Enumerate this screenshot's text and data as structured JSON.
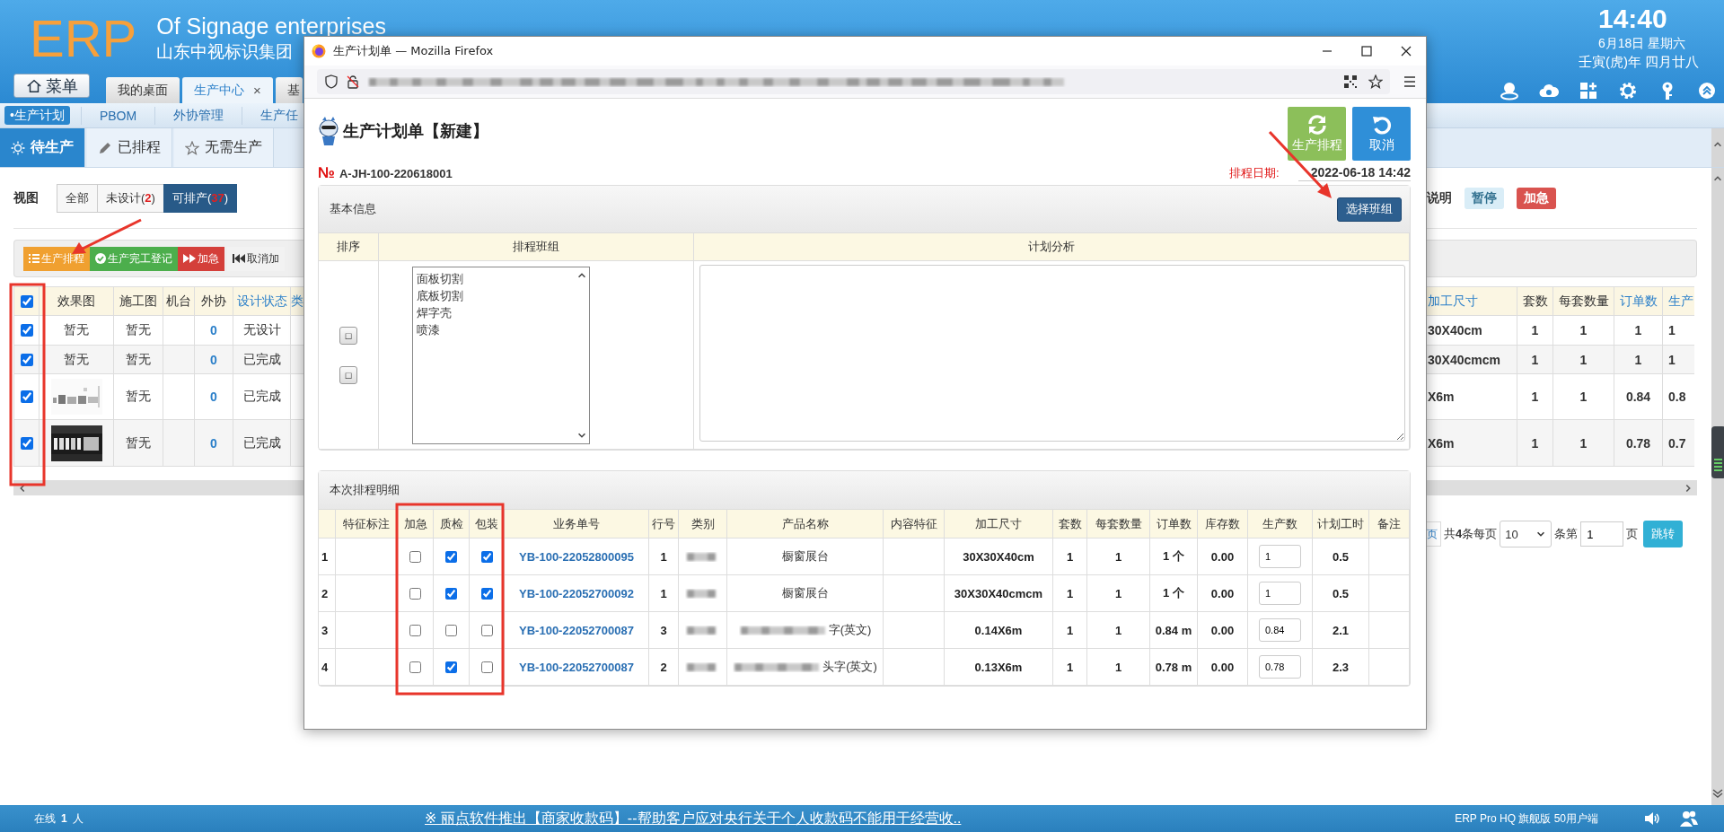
{
  "header": {
    "logo": "ERP",
    "company_en": "Of Signage enterprises",
    "company_cn": "山东中视标识集团",
    "clock": {
      "time": "14:40",
      "date": "6月18日 星期六",
      "lunar": "壬寅(虎)年 四月廿八"
    }
  },
  "menu_button": {
    "label": "菜单"
  },
  "tabs": [
    {
      "label": "我的桌面",
      "selected": false
    },
    {
      "label": "生产中心",
      "selected": true,
      "close": "×"
    },
    {
      "label": "基",
      "selected": false
    }
  ],
  "nav": [
    {
      "label": "•生产计划",
      "selected": true
    },
    {
      "label": "PBOM",
      "selected": false
    },
    {
      "label": "外协管理",
      "selected": false
    },
    {
      "label": "生产任",
      "selected": false
    }
  ],
  "subtabs": [
    {
      "label": "待生产",
      "selected": true
    },
    {
      "label": "已排程",
      "selected": false
    },
    {
      "label": "无需生产",
      "selected": false
    }
  ],
  "view": {
    "label": "视图",
    "filters": [
      {
        "label": "全部",
        "selected": false
      },
      {
        "label": "未设计(**2**)",
        "selected": false
      },
      {
        "label": "可排产(**37**)",
        "selected": true
      }
    ]
  },
  "legend": {
    "label": "说明",
    "badges": [
      {
        "label": "暂停",
        "color": "#d9edf7"
      },
      {
        "label": "加急",
        "color": "#d9534f"
      }
    ]
  },
  "toolbar": [
    {
      "label": "生产排程",
      "color": "#f0a030"
    },
    {
      "label": "生产完工登记",
      "color": "#4cae4c"
    },
    {
      "label": "加急",
      "color": "#d43f3a"
    },
    {
      "label": "取消加",
      "color": "#f2f2f2"
    }
  ],
  "table": {
    "all_checked": true,
    "left_columns": [
      {
        "label": "效果图",
        "sortable": false
      },
      {
        "label": "施工图",
        "sortable": false
      },
      {
        "label": "机台",
        "sortable": false
      },
      {
        "label": "外协",
        "sortable": false
      },
      {
        "label": "设计状态",
        "sortable": true
      },
      {
        "label": "类",
        "sortable": true
      }
    ],
    "right_columns": [
      {
        "label": "加工尺寸",
        "sortable": true
      },
      {
        "label": "套数",
        "sortable": false
      },
      {
        "label": "每套数量",
        "sortable": false
      },
      {
        "label": "订单数",
        "sortable": true
      },
      {
        "label": "生产",
        "sortable": true
      }
    ],
    "rows": [
      {
        "checked": true,
        "effect": {
          "kind": "text",
          "text": "暂无"
        },
        "drawing": "暂无",
        "outsource": "0",
        "design_status": "无设计",
        "size": "30X40cm",
        "sets": "1",
        "per_set": "1",
        "order_qty": "1",
        "production": "1"
      },
      {
        "checked": true,
        "effect": {
          "kind": "text",
          "text": "暂无"
        },
        "drawing": "暂无",
        "outsource": "0",
        "design_status": "已完成",
        "size": "30X40cmcm",
        "sets": "1",
        "per_set": "1",
        "order_qty": "1",
        "production": "1"
      },
      {
        "checked": true,
        "drawing": "暂无",
        "outsource": "0",
        "design_status": "已完成",
        "size": "X6m",
        "sets": "1",
        "per_set": "1",
        "order_qty": "0.84",
        "production": "0.8"
      },
      {
        "checked": true,
        "drawing": "暂无",
        "outsource": "0",
        "design_status": "已完成",
        "size": "X6m",
        "sets": "1",
        "per_set": "1",
        "order_qty": "0.78",
        "production": "0.7"
      }
    ]
  },
  "pager": {
    "prev": "页",
    "total": "共**4**条每页",
    "per_page": "10",
    "page_label": "条第",
    "page": "1",
    "page_suffix": "页",
    "go": "跳转"
  },
  "status_bar": {
    "online": "在线",
    "online_count": "1",
    "online_unit": "人",
    "notice": "※ 丽点软件推出【商家收款码】--帮助客户应对央行关于个人收款码不能用于经营收..",
    "edition": "ERP Pro HQ 旗舰版 50用户端"
  },
  "dialog": {
    "window_title": "生产计划单 — Mozilla Firefox",
    "title": "生产计划单【新建】",
    "actions": [
      {
        "label": "生产排程",
        "color": "#8cbf5a"
      },
      {
        "label": "取消",
        "color": "#2f8fd8"
      }
    ],
    "number_mark": "№",
    "number": "A-JH-100-220618001",
    "date_label": "排程日期:",
    "date": "2022-06-18 14:42",
    "basic": {
      "title": "基本信息",
      "select_button": "选择班组",
      "columns": [
        "排序",
        "排程班组",
        "计划分析"
      ],
      "order_buttons": [
        "□",
        "□"
      ],
      "teams": [
        "面板切割",
        "底板切割",
        "焊字壳",
        "喷漆"
      ]
    },
    "detail": {
      "title": "本次排程明细",
      "columns": [
        "特征标注",
        "加急",
        "质检",
        "包装",
        "业务单号",
        "行号",
        "类别",
        "产品名称",
        "内容特征",
        "加工尺寸",
        "套数",
        "每套数量",
        "订单数",
        "库存数",
        "生产数",
        "计划工时",
        "备注"
      ],
      "rows": [
        {
          "no": "1",
          "urgent": false,
          "qc": true,
          "pack": true,
          "order": "YB-100-22052800095",
          "line": "1",
          "product": "橱窗展台",
          "blurred": false,
          "size": "30X30X40cm",
          "sets": "1",
          "per_set": "1",
          "order_qty": "1 个",
          "stock": "0.00",
          "production": "1",
          "hours": "0.5"
        },
        {
          "no": "2",
          "urgent": false,
          "qc": true,
          "pack": true,
          "order": "YB-100-22052700092",
          "line": "1",
          "product": "橱窗展台",
          "blurred": false,
          "size": "30X30X40cmcm",
          "sets": "1",
          "per_set": "1",
          "order_qty": "1 个",
          "stock": "0.00",
          "production": "1",
          "hours": "0.5"
        },
        {
          "no": "3",
          "urgent": false,
          "qc": false,
          "pack": false,
          "order": "YB-100-22052700087",
          "line": "3",
          "product": "字(英文)",
          "blurred": true,
          "size": "0.14X6m",
          "sets": "1",
          "per_set": "1",
          "order_qty": "0.84 m",
          "stock": "0.00",
          "production": "0.84",
          "hours": "2.1"
        },
        {
          "no": "4",
          "urgent": false,
          "qc": true,
          "pack": false,
          "order": "YB-100-22052700087",
          "line": "2",
          "product": "头字(英文)",
          "blurred": true,
          "size": "0.13X6m",
          "sets": "1",
          "per_set": "1",
          "order_qty": "0.78 m",
          "stock": "0.00",
          "production": "0.78",
          "hours": "2.3"
        }
      ]
    }
  }
}
